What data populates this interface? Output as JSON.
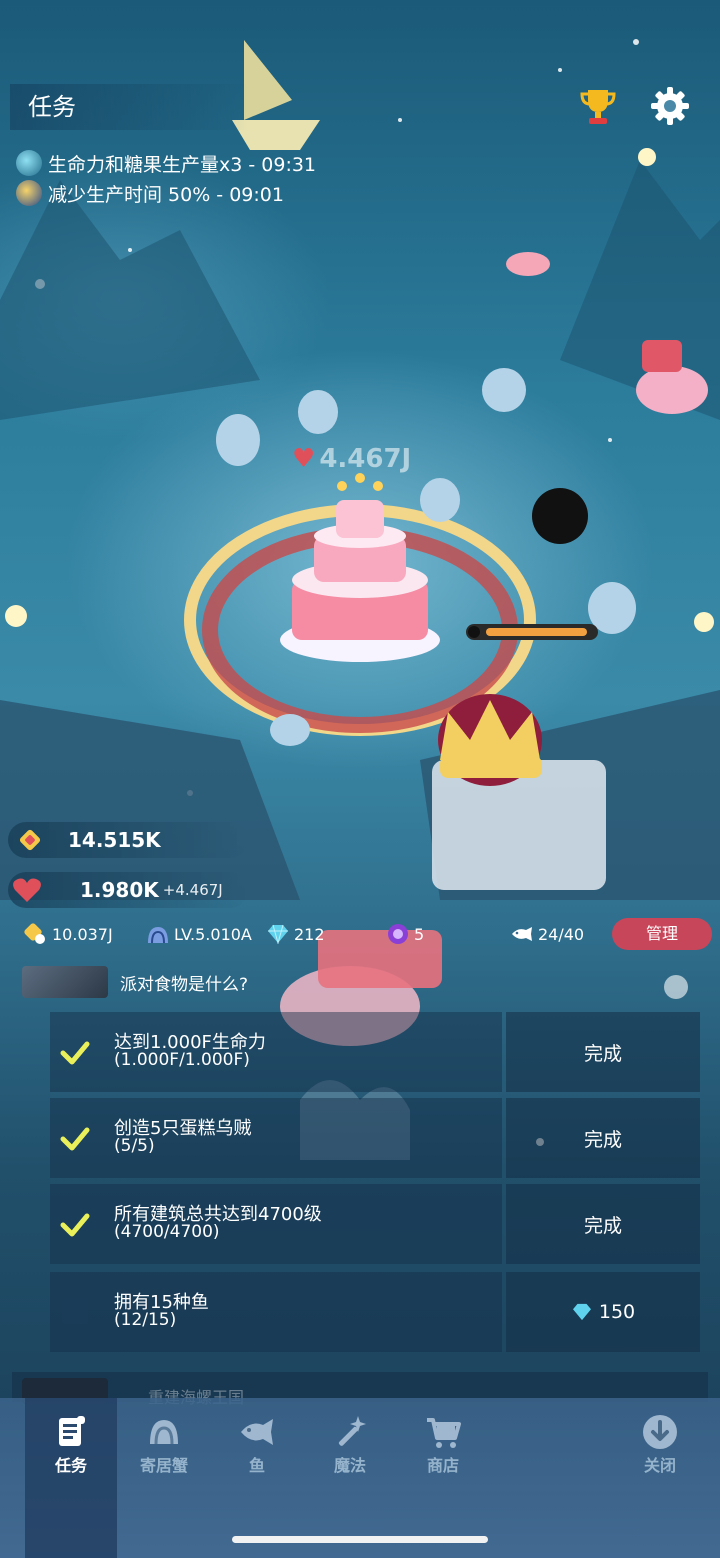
{
  "header": {
    "title": "任务",
    "buffs": [
      {
        "text": "生命力和糖果生产量x3 - 09:31"
      },
      {
        "text": "减少生产时间 50% - 09:01"
      }
    ]
  },
  "world": {
    "floating_value": "4.467J",
    "progress": 0.95
  },
  "resources": {
    "candy": "14.515K",
    "vitality": "1.980K",
    "vitality_rate": "+4.467J"
  },
  "stats": {
    "gold": "10.037J",
    "level": "LV.5.010A",
    "gems": "212",
    "magic": "5",
    "fish": "24/40",
    "manage_label": "管理"
  },
  "quest": {
    "name": "派对食物是什么?",
    "tasks": [
      {
        "line1": "达到1.000F生命力",
        "line2": "(1.000F/1.000F)",
        "action": "完成",
        "done": true
      },
      {
        "line1": "创造5只蛋糕乌贼",
        "line2": "(5/5)",
        "action": "完成",
        "done": true
      },
      {
        "line1": "所有建筑总共达到4700级",
        "line2": "(4700/4700)",
        "action": "完成",
        "done": true
      },
      {
        "line1": "拥有15种鱼",
        "line2": "(12/15)",
        "action": "150",
        "done": false
      }
    ],
    "next_name": "重建海螺王国"
  },
  "tabs": [
    {
      "label": "任务",
      "icon": "scroll-icon"
    },
    {
      "label": "寄居蟹",
      "icon": "hermit-crab-icon"
    },
    {
      "label": "鱼",
      "icon": "fish-icon"
    },
    {
      "label": "魔法",
      "icon": "magic-wand-icon"
    },
    {
      "label": "商店",
      "icon": "cart-icon"
    },
    {
      "label": "关闭",
      "icon": "close-down-icon"
    }
  ],
  "colors": {
    "accent": "#c8465a",
    "check": "#e9f05a",
    "gem": "#5fd3ee",
    "heart": "#e0505a"
  }
}
